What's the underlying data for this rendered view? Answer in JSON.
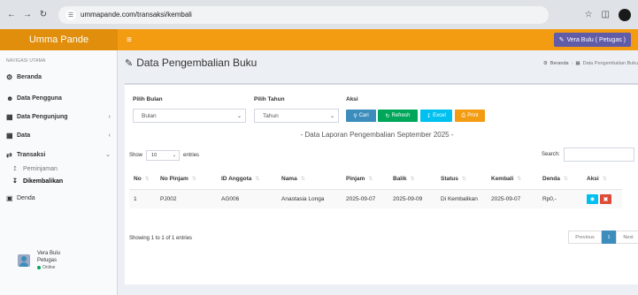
{
  "browser": {
    "url": "ummapande.com/transaksi/kembali"
  },
  "header": {
    "brand": "Umma Pande",
    "user_button": "Vera Bulu ( Petugas )"
  },
  "sidebar": {
    "section_label": "NAVIGASI UTAMA",
    "items": [
      {
        "label": "Beranda",
        "icon": "dashboard-icon"
      },
      {
        "label": "Data Pengguna",
        "icon": "users-icon"
      },
      {
        "label": "Data Pengunjung",
        "icon": "edit-icon"
      },
      {
        "label": "Data",
        "icon": "edit-icon"
      },
      {
        "label": "Transaksi",
        "icon": "exchange-icon"
      }
    ],
    "sub_items": [
      {
        "label": "Peminjaman",
        "icon": "upload-icon"
      },
      {
        "label": "Dikembalikan",
        "icon": "download-icon"
      }
    ],
    "denda": "Denda",
    "user": {
      "name": "Vera Bulu",
      "role": "Petugas",
      "status": "Online"
    }
  },
  "page": {
    "title": "Data Pengembalian Buku",
    "breadcrumb": [
      "Beranda",
      "Data Pengembalian Buku"
    ]
  },
  "filters": {
    "bulan_label": "Pilih Bulan",
    "tahun_label": "Pilih Tahun",
    "aksi_label": "Aksi",
    "bulan_value": "Bulan",
    "tahun_value": "Tahun",
    "btn_cari": "Cari",
    "btn_refresh": "Refresh",
    "btn_excel": "Excel",
    "btn_print": "Print"
  },
  "report_title": "- Data Laporan Pengembalian September 2025 -",
  "table_controls": {
    "show": "Show",
    "entries_value": "10",
    "entries": "entries",
    "search": "Search:"
  },
  "table": {
    "columns": [
      "No",
      "No Pinjam",
      "ID Anggota",
      "Nama",
      "Pinjam",
      "Balik",
      "Status",
      "Kembali",
      "Denda",
      "Aksi"
    ],
    "rows": [
      [
        "1",
        "PJ002",
        "AG006",
        "Anastasia Longa",
        "2025-09-07",
        "2025-09-09",
        "Di Kembalikan",
        "2025-09-07",
        "Rp0,-"
      ]
    ]
  },
  "footer": {
    "showing": "Showing 1 to 1 of 1 entries",
    "previous": "Previous",
    "page": "1",
    "next": "Next"
  }
}
